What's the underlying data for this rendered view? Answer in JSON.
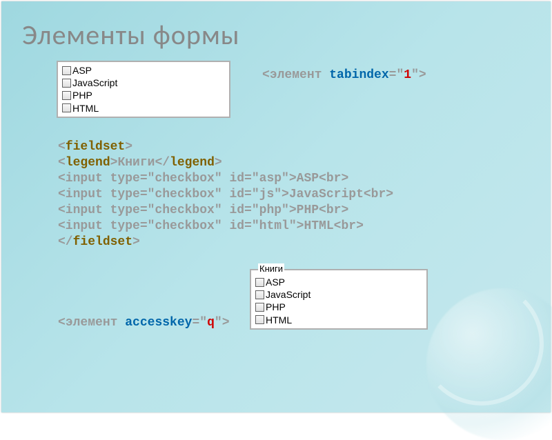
{
  "title": "Элементы формы",
  "box1": {
    "items": [
      "ASP",
      "JavaScript",
      "PHP",
      "HTML"
    ]
  },
  "box2": {
    "legend": "Книги",
    "items": [
      "ASP",
      "JavaScript",
      "PHP",
      "HTML"
    ]
  },
  "tabindex_line": {
    "element_word": "элемент",
    "attr": "tabindex",
    "val": "1"
  },
  "accesskey_line": {
    "element_word": "элемент",
    "attr": "accesskey",
    "val": "q"
  },
  "code": {
    "l1_open": "<",
    "l1_tag": "fieldset",
    "l1_close": ">",
    "l2_open": "<",
    "l2_tag": "legend",
    "l2_close": ">",
    "l2_text": "Книги",
    "l2_endopen": "</",
    "l2_endtag": "legend",
    "l2_endclose": ">",
    "l3": "<input type=\"checkbox\" id=\"asp\">ASP<br>",
    "l4": "<input type=\"checkbox\" id=\"js\">JavaScript<br>",
    "l5": "<input type=\"checkbox\" id=\"php\">PHP<br>",
    "l6": "<input type=\"checkbox\" id=\"html\">HTML<br>",
    "l7_open": "</",
    "l7_tag": "fieldset",
    "l7_close": ">"
  }
}
